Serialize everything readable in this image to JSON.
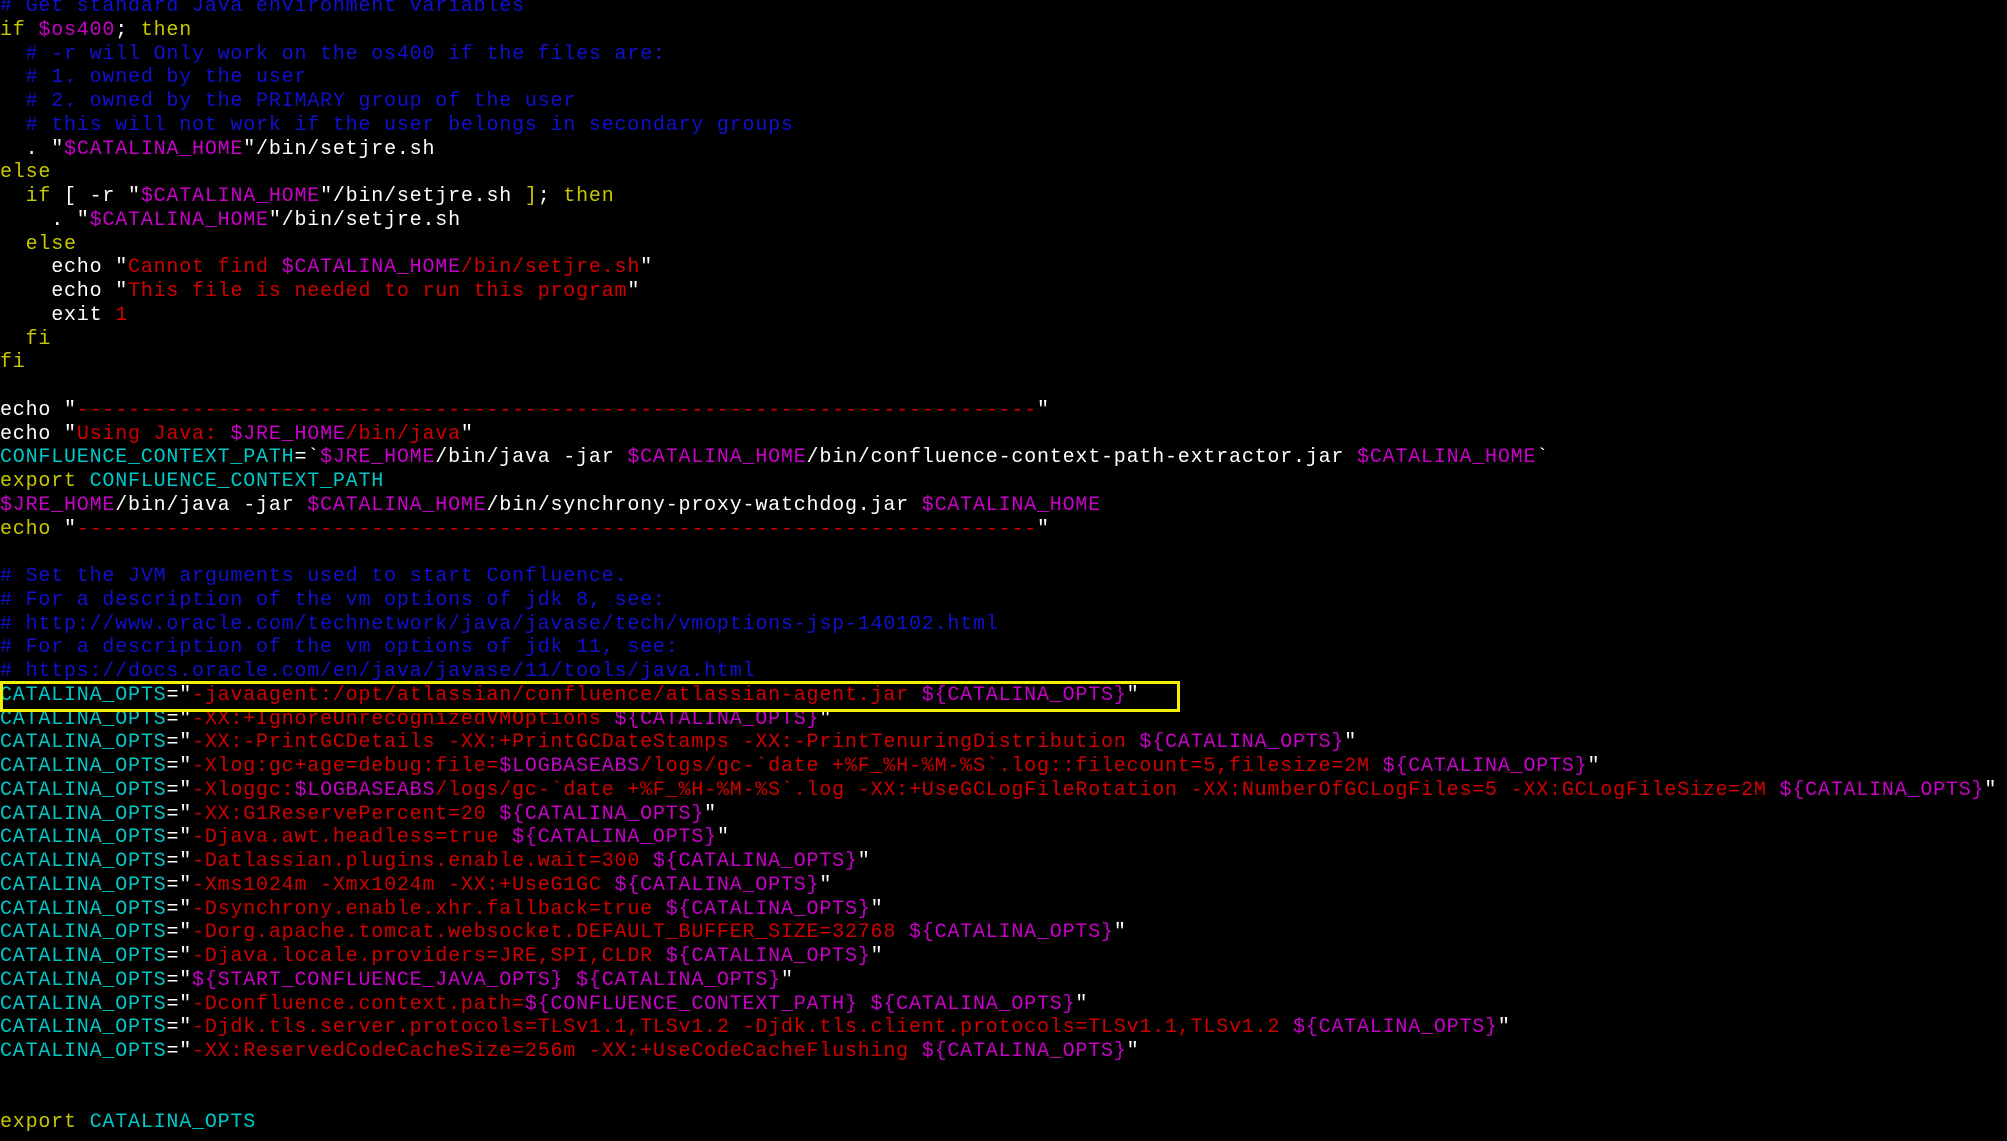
{
  "colors": {
    "background": "#000000",
    "comment": "#1010d0",
    "keyword": "#c8c800",
    "variable": "#c800c8",
    "string": "#d00000",
    "command": "#ffffff",
    "identifier": "#00c8c8",
    "highlight_box": "#f2f200"
  },
  "highlighted_line_index": 29,
  "lines": [
    [
      {
        "t": "# Get standard Java environment variables",
        "c": "comment"
      }
    ],
    [
      {
        "t": "if ",
        "c": "keyword"
      },
      {
        "t": "$os400",
        "c": "variable"
      },
      {
        "t": "; ",
        "c": "command"
      },
      {
        "t": "then",
        "c": "keyword"
      }
    ],
    [
      {
        "t": "  # -r will Only work on the os400 if the files are:",
        "c": "comment"
      }
    ],
    [
      {
        "t": "  # 1. owned by the user",
        "c": "comment"
      }
    ],
    [
      {
        "t": "  # 2. owned by the PRIMARY group of the user",
        "c": "comment"
      }
    ],
    [
      {
        "t": "  # this will not work if the user belongs in secondary groups",
        "c": "comment"
      }
    ],
    [
      {
        "t": "  . \"",
        "c": "command"
      },
      {
        "t": "$CATALINA_HOME",
        "c": "variable"
      },
      {
        "t": "\"/bin/setjre.sh",
        "c": "command"
      }
    ],
    [
      {
        "t": "else",
        "c": "keyword"
      }
    ],
    [
      {
        "t": "  if ",
        "c": "keyword"
      },
      {
        "t": "[ -r \"",
        "c": "command"
      },
      {
        "t": "$CATALINA_HOME",
        "c": "variable"
      },
      {
        "t": "\"/bin/setjre.sh ",
        "c": "command"
      },
      {
        "t": "]",
        "c": "keyword"
      },
      {
        "t": "; ",
        "c": "command"
      },
      {
        "t": "then",
        "c": "keyword"
      }
    ],
    [
      {
        "t": "    . \"",
        "c": "command"
      },
      {
        "t": "$CATALINA_HOME",
        "c": "variable"
      },
      {
        "t": "\"/bin/setjre.sh",
        "c": "command"
      }
    ],
    [
      {
        "t": "  else",
        "c": "keyword"
      }
    ],
    [
      {
        "t": "    echo ",
        "c": "command"
      },
      {
        "t": "\"",
        "c": "command"
      },
      {
        "t": "Cannot find ",
        "c": "string"
      },
      {
        "t": "$CATALINA_HOME",
        "c": "variable"
      },
      {
        "t": "/bin/setjre.sh",
        "c": "string"
      },
      {
        "t": "\"",
        "c": "command"
      }
    ],
    [
      {
        "t": "    echo ",
        "c": "command"
      },
      {
        "t": "\"",
        "c": "command"
      },
      {
        "t": "This file is needed to run this program",
        "c": "string"
      },
      {
        "t": "\"",
        "c": "command"
      }
    ],
    [
      {
        "t": "    exit ",
        "c": "command"
      },
      {
        "t": "1",
        "c": "string"
      }
    ],
    [
      {
        "t": "  fi",
        "c": "keyword"
      }
    ],
    [
      {
        "t": "fi",
        "c": "keyword"
      }
    ],
    [],
    [
      {
        "t": "echo ",
        "c": "command"
      },
      {
        "t": "\"",
        "c": "command"
      },
      {
        "t": "---------------------------------------------------------------------------",
        "c": "string"
      },
      {
        "t": "\"",
        "c": "command"
      }
    ],
    [
      {
        "t": "echo ",
        "c": "command"
      },
      {
        "t": "\"",
        "c": "command"
      },
      {
        "t": "Using Java: ",
        "c": "string"
      },
      {
        "t": "$JRE_HOME",
        "c": "variable"
      },
      {
        "t": "/bin/java",
        "c": "string"
      },
      {
        "t": "\"",
        "c": "command"
      }
    ],
    [
      {
        "t": "CONFLUENCE_CONTEXT_PATH",
        "c": "identifier"
      },
      {
        "t": "=`",
        "c": "command"
      },
      {
        "t": "$JRE_HOME",
        "c": "variable"
      },
      {
        "t": "/bin/java -jar ",
        "c": "command"
      },
      {
        "t": "$CATALINA_HOME",
        "c": "variable"
      },
      {
        "t": "/bin/confluence-context-path-extractor.jar ",
        "c": "command"
      },
      {
        "t": "$CATALINA_HOME",
        "c": "variable"
      },
      {
        "t": "`",
        "c": "command"
      }
    ],
    [
      {
        "t": "export ",
        "c": "keyword"
      },
      {
        "t": "CONFLUENCE_CONTEXT_PATH",
        "c": "identifier"
      }
    ],
    [
      {
        "t": "$JRE_HOME",
        "c": "variable"
      },
      {
        "t": "/bin/java ",
        "c": "command"
      },
      {
        "t": "-jar ",
        "c": "command"
      },
      {
        "t": "$CATALINA_HOME",
        "c": "variable"
      },
      {
        "t": "/bin/synchrony-proxy-watchdog.jar ",
        "c": "command"
      },
      {
        "t": "$CATALINA_HOME",
        "c": "variable"
      }
    ],
    [
      {
        "t": "echo ",
        "c": "keyword"
      },
      {
        "t": "\"",
        "c": "command"
      },
      {
        "t": "---------------------------------------------------------------------------",
        "c": "string"
      },
      {
        "t": "\"",
        "c": "command"
      }
    ],
    [],
    [
      {
        "t": "# Set the JVM arguments used to start Confluence.",
        "c": "comment"
      }
    ],
    [
      {
        "t": "# For a description of the vm options of jdk 8, see:",
        "c": "comment"
      }
    ],
    [
      {
        "t": "# http://www.oracle.com/technetwork/java/javase/tech/vmoptions-jsp-140102.html",
        "c": "comment"
      }
    ],
    [
      {
        "t": "# For a description of the vm options of jdk 11, see:",
        "c": "comment"
      }
    ],
    [
      {
        "t": "# https://docs.oracle.com/en/java/javase/11/tools/java.html",
        "c": "comment"
      }
    ],
    [
      {
        "t": "CATALINA_OPTS",
        "c": "identifier"
      },
      {
        "t": "=\"",
        "c": "command"
      },
      {
        "t": "-javaagent:/opt/atlassian/confluence/atlassian-agent.jar ",
        "c": "string"
      },
      {
        "t": "${CATALINA_OPTS}",
        "c": "variable"
      },
      {
        "t": "\"",
        "c": "command"
      }
    ],
    [
      {
        "t": "CATALINA_OPTS",
        "c": "identifier"
      },
      {
        "t": "=\"",
        "c": "command"
      },
      {
        "t": "-XX:+IgnoreUnrecognizedVMOptions ",
        "c": "string"
      },
      {
        "t": "${CATALINA_OPTS}",
        "c": "variable"
      },
      {
        "t": "\"",
        "c": "command"
      }
    ],
    [
      {
        "t": "CATALINA_OPTS",
        "c": "identifier"
      },
      {
        "t": "=\"",
        "c": "command"
      },
      {
        "t": "-XX:-PrintGCDetails -XX:+PrintGCDateStamps -XX:-PrintTenuringDistribution ",
        "c": "string"
      },
      {
        "t": "${CATALINA_OPTS}",
        "c": "variable"
      },
      {
        "t": "\"",
        "c": "command"
      }
    ],
    [
      {
        "t": "CATALINA_OPTS",
        "c": "identifier"
      },
      {
        "t": "=\"",
        "c": "command"
      },
      {
        "t": "-Xlog:gc+age=debug:file=",
        "c": "string"
      },
      {
        "t": "$LOGBASEABS",
        "c": "variable"
      },
      {
        "t": "/logs/gc-`date +%F_%H-%M-%S`.log::filecount=5,filesize=2M ",
        "c": "string"
      },
      {
        "t": "${CATALINA_OPTS}",
        "c": "variable"
      },
      {
        "t": "\"",
        "c": "command"
      }
    ],
    [
      {
        "t": "CATALINA_OPTS",
        "c": "identifier"
      },
      {
        "t": "=\"",
        "c": "command"
      },
      {
        "t": "-Xloggc:",
        "c": "string"
      },
      {
        "t": "$LOGBASEABS",
        "c": "variable"
      },
      {
        "t": "/logs/gc-`date +%F_%H-%M-%S`.log -XX:+UseGCLogFileRotation -XX:NumberOfGCLogFiles=5 -XX:GCLogFileSize=2M ",
        "c": "string"
      },
      {
        "t": "${CATALINA_OPTS}",
        "c": "variable"
      },
      {
        "t": "\"",
        "c": "command"
      }
    ],
    [
      {
        "t": "CATALINA_OPTS",
        "c": "identifier"
      },
      {
        "t": "=\"",
        "c": "command"
      },
      {
        "t": "-XX:G1ReservePercent=20 ",
        "c": "string"
      },
      {
        "t": "${CATALINA_OPTS}",
        "c": "variable"
      },
      {
        "t": "\"",
        "c": "command"
      }
    ],
    [
      {
        "t": "CATALINA_OPTS",
        "c": "identifier"
      },
      {
        "t": "=\"",
        "c": "command"
      },
      {
        "t": "-Djava.awt.headless=true ",
        "c": "string"
      },
      {
        "t": "${CATALINA_OPTS}",
        "c": "variable"
      },
      {
        "t": "\"",
        "c": "command"
      }
    ],
    [
      {
        "t": "CATALINA_OPTS",
        "c": "identifier"
      },
      {
        "t": "=\"",
        "c": "command"
      },
      {
        "t": "-Datlassian.plugins.enable.wait=300 ",
        "c": "string"
      },
      {
        "t": "${CATALINA_OPTS}",
        "c": "variable"
      },
      {
        "t": "\"",
        "c": "command"
      }
    ],
    [
      {
        "t": "CATALINA_OPTS",
        "c": "identifier"
      },
      {
        "t": "=\"",
        "c": "command"
      },
      {
        "t": "-Xms1024m -Xmx1024m -XX:+UseG1GC ",
        "c": "string"
      },
      {
        "t": "${CATALINA_OPTS}",
        "c": "variable"
      },
      {
        "t": "\"",
        "c": "command"
      }
    ],
    [
      {
        "t": "CATALINA_OPTS",
        "c": "identifier"
      },
      {
        "t": "=\"",
        "c": "command"
      },
      {
        "t": "-Dsynchrony.enable.xhr.fallback=true ",
        "c": "string"
      },
      {
        "t": "${CATALINA_OPTS}",
        "c": "variable"
      },
      {
        "t": "\"",
        "c": "command"
      }
    ],
    [
      {
        "t": "CATALINA_OPTS",
        "c": "identifier"
      },
      {
        "t": "=\"",
        "c": "command"
      },
      {
        "t": "-Dorg.apache.tomcat.websocket.DEFAULT_BUFFER_SIZE=32768 ",
        "c": "string"
      },
      {
        "t": "${CATALINA_OPTS}",
        "c": "variable"
      },
      {
        "t": "\"",
        "c": "command"
      }
    ],
    [
      {
        "t": "CATALINA_OPTS",
        "c": "identifier"
      },
      {
        "t": "=\"",
        "c": "command"
      },
      {
        "t": "-Djava.locale.providers=JRE,SPI,CLDR ",
        "c": "string"
      },
      {
        "t": "${CATALINA_OPTS}",
        "c": "variable"
      },
      {
        "t": "\"",
        "c": "command"
      }
    ],
    [
      {
        "t": "CATALINA_OPTS",
        "c": "identifier"
      },
      {
        "t": "=\"",
        "c": "command"
      },
      {
        "t": "${START_CONFLUENCE_JAVA_OPTS} ${CATALINA_OPTS}",
        "c": "variable"
      },
      {
        "t": "\"",
        "c": "command"
      }
    ],
    [
      {
        "t": "CATALINA_OPTS",
        "c": "identifier"
      },
      {
        "t": "=\"",
        "c": "command"
      },
      {
        "t": "-Dconfluence.context.path=",
        "c": "string"
      },
      {
        "t": "${CONFLUENCE_CONTEXT_PATH} ${CATALINA_OPTS}",
        "c": "variable"
      },
      {
        "t": "\"",
        "c": "command"
      }
    ],
    [
      {
        "t": "CATALINA_OPTS",
        "c": "identifier"
      },
      {
        "t": "=\"",
        "c": "command"
      },
      {
        "t": "-Djdk.tls.server.protocols=TLSv1.1,TLSv1.2 -Djdk.tls.client.protocols=TLSv1.1,TLSv1.2 ",
        "c": "string"
      },
      {
        "t": "${CATALINA_OPTS}",
        "c": "variable"
      },
      {
        "t": "\"",
        "c": "command"
      }
    ],
    [
      {
        "t": "CATALINA_OPTS",
        "c": "identifier"
      },
      {
        "t": "=\"",
        "c": "command"
      },
      {
        "t": "-XX:ReservedCodeCacheSize=256m -XX:+UseCodeCacheFlushing ",
        "c": "string"
      },
      {
        "t": "${CATALINA_OPTS}",
        "c": "variable"
      },
      {
        "t": "\"",
        "c": "command"
      }
    ],
    [],
    [],
    [
      {
        "t": "export ",
        "c": "keyword"
      },
      {
        "t": "CATALINA_OPTS",
        "c": "identifier"
      }
    ]
  ]
}
